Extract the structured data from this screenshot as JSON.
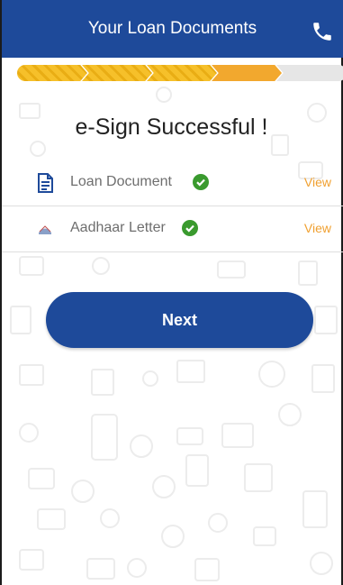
{
  "header": {
    "title": "Your Loan Documents",
    "phone_icon": "phone-icon",
    "color": "#1e4a9a"
  },
  "progress": {
    "steps": [
      "done",
      "done",
      "done",
      "current",
      "pending"
    ]
  },
  "status": {
    "title": "e-Sign Successful !"
  },
  "documents": [
    {
      "label": "Loan Document",
      "icon": "document-icon",
      "verified": true,
      "action": "View"
    },
    {
      "label": "Aadhaar Letter",
      "icon": "aadhaar-icon",
      "verified": true,
      "action": "View"
    }
  ],
  "actions": {
    "next_label": "Next"
  },
  "colors": {
    "primary": "#1e4a9a",
    "accent": "#f0a030",
    "success": "#3a9a2e"
  }
}
